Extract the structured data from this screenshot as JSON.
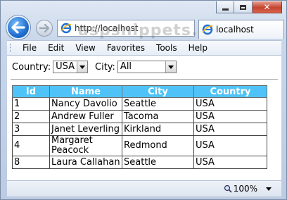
{
  "browser": {
    "url": "http://localhost",
    "tab_title": "localhost",
    "watermark": "aspsnippets.com",
    "zoom": "100%",
    "caption": {
      "minimize": "minimize",
      "maximize": "maximize",
      "close": "✕"
    }
  },
  "menu": [
    "File",
    "Edit",
    "View",
    "Favorites",
    "Tools",
    "Help"
  ],
  "filters": {
    "country_label": "Country:",
    "country_value": "USA",
    "city_label": "City:",
    "city_value": "All"
  },
  "grid": {
    "headers": [
      "Id",
      "Name",
      "City",
      "Country"
    ],
    "rows": [
      {
        "id": "1",
        "name": "Nancy Davolio",
        "city": "Seattle",
        "country": "USA"
      },
      {
        "id": "2",
        "name": "Andrew Fuller",
        "city": "Tacoma",
        "country": "USA"
      },
      {
        "id": "3",
        "name": "Janet Leverling",
        "city": "Kirkland",
        "country": "USA"
      },
      {
        "id": "4",
        "name": "Margaret Peacock",
        "city": "Redmond",
        "country": "USA"
      },
      {
        "id": "8",
        "name": "Laura Callahan",
        "city": "Seattle",
        "country": "USA"
      }
    ]
  },
  "colors": {
    "header_bg": "#4fc3f7",
    "header_text": "#ffffff"
  },
  "icons": {
    "back": "back-arrow-icon",
    "forward": "forward-arrow-icon",
    "ie": "ie-logo-icon",
    "zoom": "magnifier-icon"
  }
}
